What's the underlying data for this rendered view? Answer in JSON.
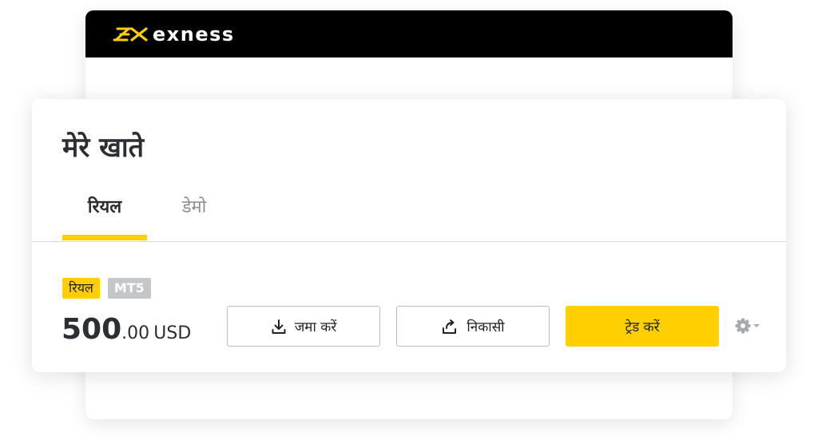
{
  "header": {
    "brand": "exness",
    "brand_color": "#ffcf01",
    "logo_icon": "exness-logo-icon"
  },
  "accounts": {
    "title": "मेरे खाते",
    "tabs": [
      {
        "label": "रियल",
        "active": true
      },
      {
        "label": "डेमो",
        "active": false
      }
    ]
  },
  "account": {
    "type_badge": "रियल",
    "platform_badge": "MT5",
    "balance_int": "500",
    "balance_dec": ".00",
    "currency": "USD"
  },
  "actions": {
    "deposit_label": "जमा करें",
    "deposit_icon": "download-icon",
    "withdraw_label": "निकासी",
    "withdraw_icon": "share-icon",
    "trade_label": "ट्रेड करें",
    "settings_icon": "gear-icon",
    "settings_caret_icon": "caret-down-icon"
  },
  "colors": {
    "accent": "#ffcf01",
    "header_bg": "#000000",
    "text": "#2b2f33",
    "muted": "#8b8f93",
    "badge_gray": "#c4c7ca"
  }
}
